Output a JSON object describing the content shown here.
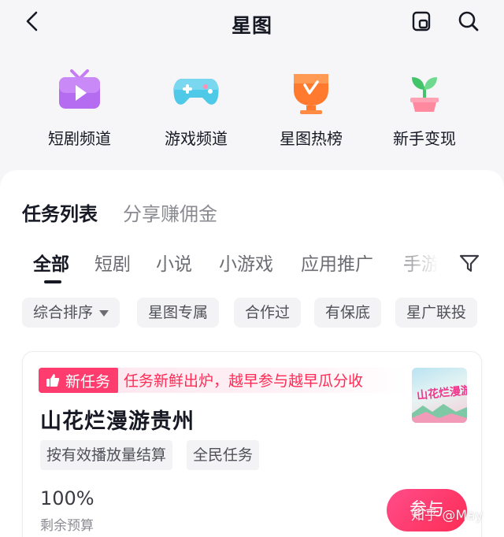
{
  "header": {
    "title": "星图",
    "back_icon": "chevron-left-icon",
    "icon_a": "square-layout-icon",
    "icon_b": "search-icon"
  },
  "quick_entries": [
    {
      "label": "短剧频道",
      "icon": "tv-play-icon",
      "color": "#b86cf0"
    },
    {
      "label": "游戏频道",
      "icon": "gamepad-icon",
      "color": "#4fc9e8"
    },
    {
      "label": "星图热榜",
      "icon": "trophy-icon",
      "color": "#ff7a2e"
    },
    {
      "label": "新手变现",
      "icon": "sprout-icon",
      "color": "#43c46a"
    }
  ],
  "list_tabs": {
    "active": "任务列表",
    "inactive": "分享赚佣金"
  },
  "categories": [
    "全部",
    "短剧",
    "小说",
    "小游戏",
    "应用推广",
    "手游"
  ],
  "filter_icon": "filter-funnel-icon",
  "chips": [
    {
      "label": "综合排序"
    },
    {
      "label": "星图专属"
    },
    {
      "label": "合作过"
    },
    {
      "label": "有保底"
    },
    {
      "label": "星广联投"
    }
  ],
  "task_card": {
    "badge": "新任务",
    "badge_icon": "thumbs-up-icon",
    "banner": "任务新鲜出炉，越早参与越早瓜分收",
    "thumbnail_text": "山花烂漫游贵州",
    "title": "山花烂漫游贵州",
    "tags": [
      "按有效播放量结算",
      "全民任务"
    ],
    "budget_value": "100%",
    "budget_label": "剩余预算",
    "join_label": "参与"
  },
  "watermark": "知乎 @May",
  "colors": {
    "accent": "#fe2c55",
    "text": "#161823",
    "muted": "#8a8b91"
  }
}
